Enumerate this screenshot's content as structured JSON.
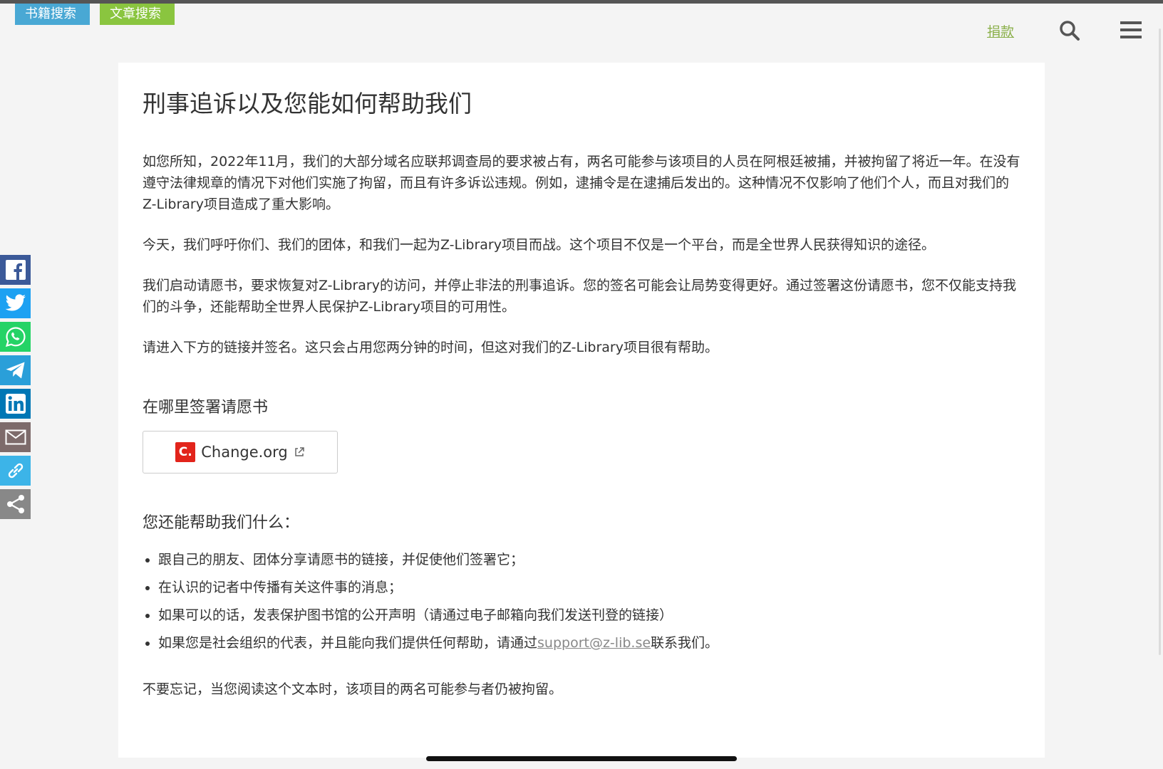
{
  "top_tabs": {
    "books": "书籍搜索",
    "articles": "文章搜索"
  },
  "header": {
    "donate": "捐款"
  },
  "article": {
    "title": "刑事追诉以及您能如何帮助我们",
    "paragraphs": [
      "如您所知，2022年11月，我们的大部分域名应联邦调查局的要求被占有，两名可能参与该项目的人员在阿根廷被捕，并被拘留了将近一年。在没有遵守法律规章的情况下对他们实施了拘留，而且有许多诉讼违规。例如，逮捕令是在逮捕后发出的。这种情况不仅影响了他们个人，而且对我们的Z-Library项目造成了重大影响。",
      "今天，我们呼吁你们、我们的团体，和我们一起为Z-Library项目而战。这个项目不仅是一个平台，而是全世界人民获得知识的途径。",
      "我们启动请愿书，要求恢复对Z-Library的访问，并停止非法的刑事追诉。您的签名可能会让局势变得更好。通过签署这份请愿书，您不仅能支持我们的斗争，还能帮助全世界人民保护Z-Library项目的可用性。",
      "请进入下方的链接并签名。这只会占用您两分钟的时间，但这对我们的Z-Library项目很有帮助。"
    ],
    "sign_heading": "在哪里签署请愿书",
    "petition": {
      "logo": "C.",
      "label": "Change.org"
    },
    "help_heading": "您还能帮助我们什么：",
    "help_items": [
      "跟自己的朋友、团体分享请愿书的链接，并促使他们签署它；",
      "在认识的记者中传播有关这件事的消息；",
      "如果可以的话，发表保护图书馆的公开声明（请通过电子邮箱向我们发送刊登的链接）"
    ],
    "help_last": {
      "prefix": "如果您是社会组织的代表，并且能向我们提供任何帮助，请通过",
      "email": "support@z-lib.se",
      "suffix": "联系我们。"
    },
    "closing": "不要忘记，当您阅读这个文本时，该项目的两名可能参与者仍被拘留。"
  },
  "share_icons": [
    "facebook-icon",
    "twitter-icon",
    "whatsapp-icon",
    "telegram-icon",
    "linkedin-icon",
    "email-icon",
    "link-icon",
    "share-icon"
  ],
  "colors": {
    "books_tab": "#49a8d4",
    "articles_tab": "#8ac53f",
    "donate": "#8bb04b",
    "facebook": "#3b5998",
    "twitter": "#1da1f2",
    "whatsapp": "#25d366",
    "telegram": "#2a9fd9",
    "linkedin": "#0077b5",
    "email": "#7d6b6b",
    "link": "#3cb4e8",
    "share": "#888888"
  }
}
